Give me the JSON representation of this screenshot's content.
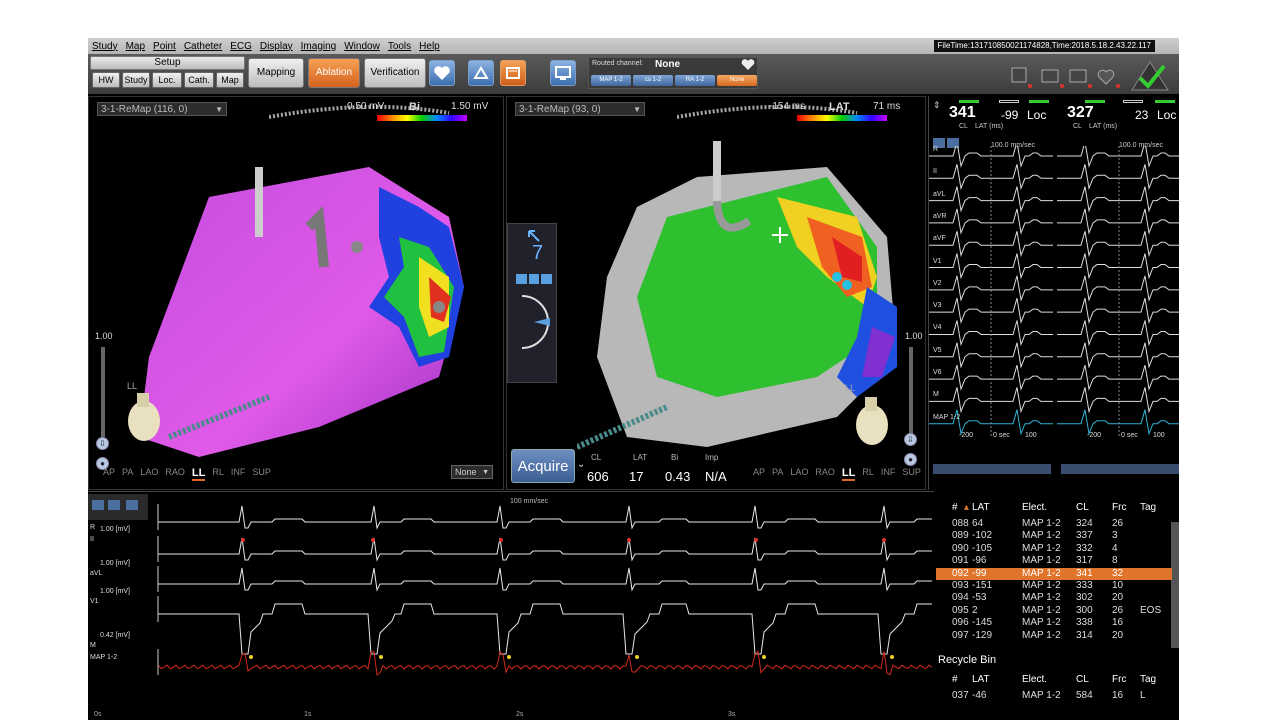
{
  "menu": [
    "Study",
    "Map",
    "Point",
    "Catheter",
    "ECG",
    "Display",
    "Imaging",
    "Window",
    "Tools",
    "Help"
  ],
  "fileinfo": "FileTime:131710850021174828,Time:2018.5.18.2.43.22.117",
  "toolbar": {
    "setup_label": "Setup",
    "setup_buttons": [
      "HW",
      "Study",
      "Loc.",
      "Cath.",
      "Map"
    ],
    "mode_buttons": [
      "Mapping",
      "Ablation",
      "Verification"
    ],
    "active_mode": "Ablation",
    "routed_label": "Routed channel:",
    "routed_value": "None",
    "channels": [
      "MAP 1-2",
      "cs 1-2",
      "RA 1-2",
      "None"
    ],
    "selected_channel": "None"
  },
  "map_left": {
    "select": "3-1-ReMap (116, 0)",
    "scale_min": "0.50 mV",
    "scale_type": "Bi",
    "scale_max": "1.50 mV",
    "side_value": "1.00",
    "views": [
      "AP",
      "PA",
      "LAO",
      "RAO",
      "LL",
      "RL",
      "INF",
      "SUP"
    ],
    "current_view": "LL",
    "orient_label": "LL",
    "dropdown": "None"
  },
  "map_right": {
    "select": "3-1-ReMap (93, 0)",
    "scale_min": "-154 ms",
    "scale_type": "LAT",
    "scale_max": "71 ms",
    "side_value": "1.00",
    "views": [
      "AP",
      "PA",
      "LAO",
      "RAO",
      "LL",
      "RL",
      "INF",
      "SUP"
    ],
    "current_view": "LL",
    "orient_label": "LL",
    "panel_number": "7",
    "acquire_label": "Acquire",
    "stats": {
      "headers": [
        "CL",
        "LAT",
        "Bi",
        "Imp"
      ],
      "values": [
        "606",
        "17",
        "0.43",
        "N/A"
      ]
    }
  },
  "egm": {
    "col1": {
      "cl": "341",
      "lat": "-99",
      "loc": "Loc",
      "sub_cl": "CL",
      "sub_lat": "LAT (ms)",
      "speed": "100.0 mm/sec",
      "ticks": [
        "-200",
        "0 sec",
        "100"
      ]
    },
    "col2": {
      "cl": "327",
      "lat": "23",
      "loc": "Loc",
      "sub_cl": "CL",
      "sub_lat": "LAT (ms)",
      "speed": "100.0 mm/sec",
      "ticks": [
        "-200",
        "0 sec",
        "100"
      ]
    },
    "leads": [
      "R",
      "II",
      "aVL",
      "aVR",
      "aVF",
      "V1",
      "V2",
      "V3",
      "V4",
      "V5",
      "V6",
      "M",
      "MAP 1-2"
    ]
  },
  "ecg": {
    "speed": "100 mm/sec",
    "leads": [
      {
        "label": "R",
        "gain": ""
      },
      {
        "label": "II",
        "gain": "1.00 [mV]"
      },
      {
        "label": "aVL",
        "gain": "1.00 [mV]"
      },
      {
        "label": "V1",
        "gain": "1.00 [mV]"
      },
      {
        "label": "M",
        "gain": "0.42 [mV]"
      },
      {
        "label": "MAP 1-2",
        "gain": ""
      }
    ],
    "time_ticks": [
      "0s",
      "1s",
      "2s",
      "3s"
    ]
  },
  "point_table": {
    "headers": [
      "#",
      "LAT",
      "Elect.",
      "CL",
      "Frc",
      "Tag"
    ],
    "rows": [
      [
        "088",
        "64",
        "MAP 1-2",
        "324",
        "26",
        ""
      ],
      [
        "089",
        "-102",
        "MAP 1-2",
        "337",
        "3",
        ""
      ],
      [
        "090",
        "-105",
        "MAP 1-2",
        "332",
        "4",
        ""
      ],
      [
        "091",
        "-96",
        "MAP 1-2",
        "317",
        "8",
        ""
      ],
      [
        "092",
        "-99",
        "MAP 1-2",
        "341",
        "32",
        ""
      ],
      [
        "093",
        "-151",
        "MAP 1-2",
        "333",
        "10",
        ""
      ],
      [
        "094",
        "-53",
        "MAP 1-2",
        "302",
        "20",
        ""
      ],
      [
        "095",
        "2",
        "MAP 1-2",
        "300",
        "26",
        "EOS"
      ],
      [
        "096",
        "-145",
        "MAP 1-2",
        "338",
        "16",
        ""
      ],
      [
        "097",
        "-129",
        "MAP 1-2",
        "314",
        "20",
        ""
      ]
    ],
    "selected_row": "092"
  },
  "recycle": {
    "title": "Recycle Bin",
    "headers": [
      "#",
      "LAT",
      "Elect.",
      "CL",
      "Frc",
      "Tag"
    ],
    "rows": [
      [
        "037",
        "-46",
        "MAP 1-2",
        "584",
        "16",
        "L"
      ]
    ]
  },
  "colors": {
    "accent": "#e0742a",
    "blue_btn": "#3b5e93",
    "ecg_trace": "#e8e8e8",
    "map_trace": "#d42a1c",
    "egm_map_trace": "#2fb3d6"
  }
}
